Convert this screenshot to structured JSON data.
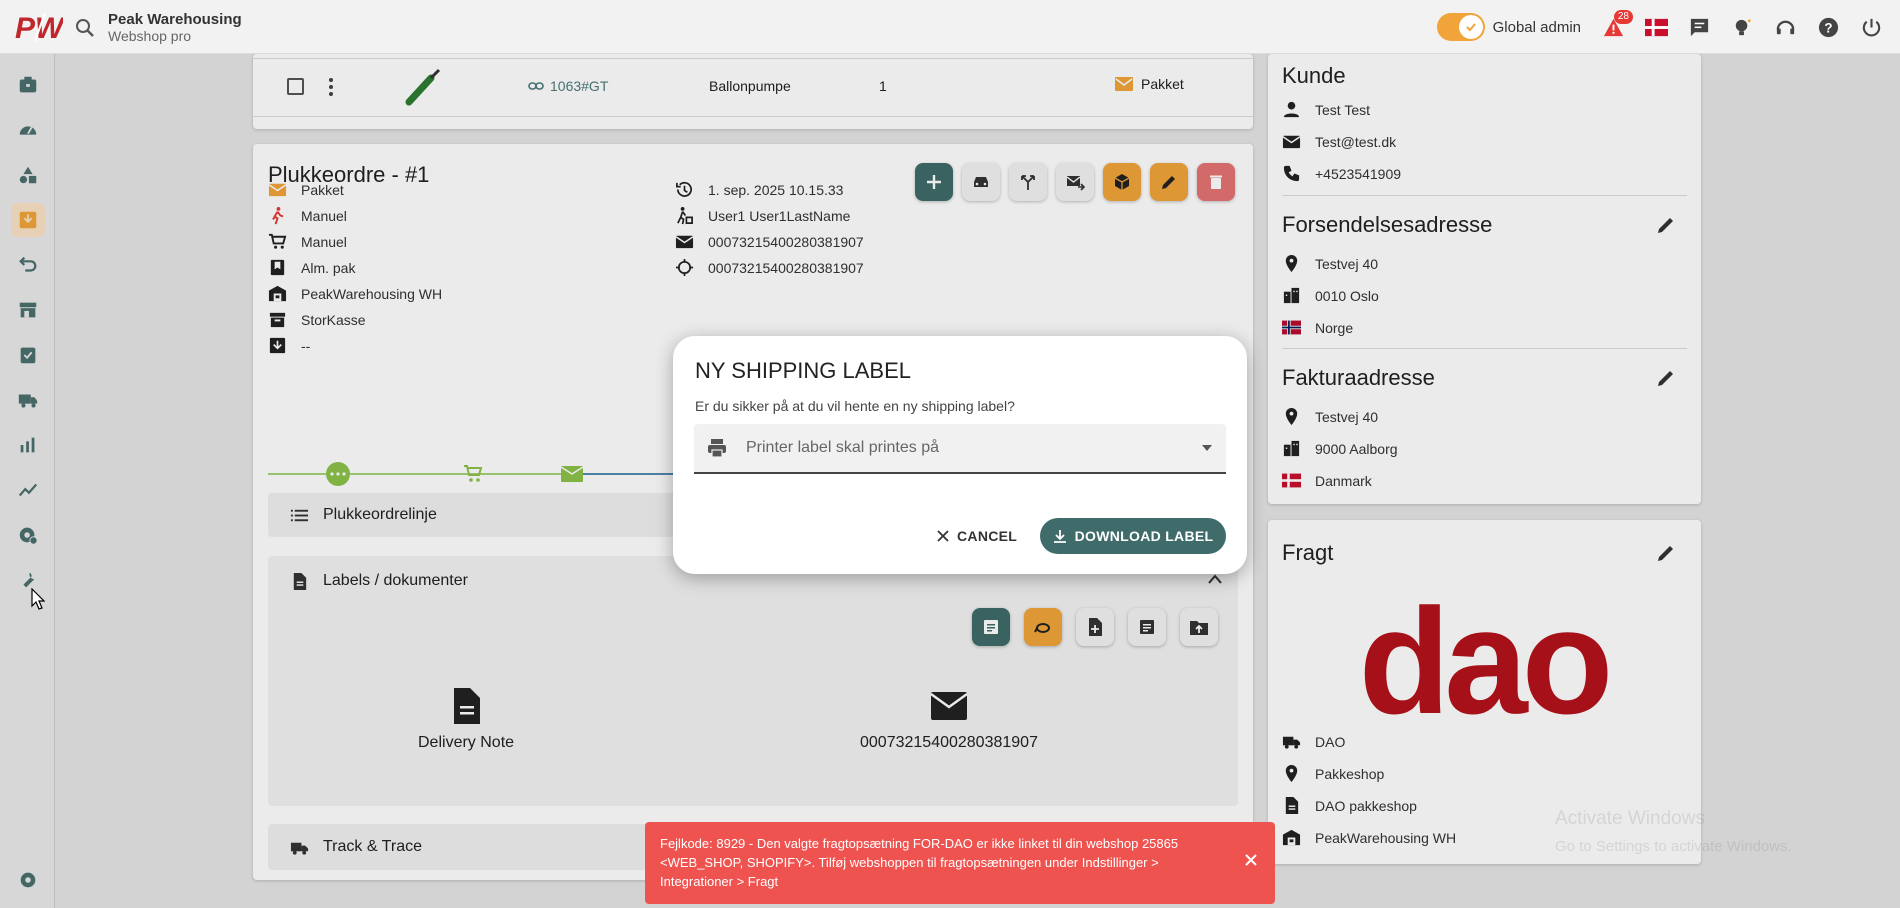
{
  "app": {
    "brand_name": "Peak Warehousing",
    "brand_sub": "Webshop pro",
    "logo_text": "PW"
  },
  "topbar": {
    "admin_label": "Global admin",
    "alert_count": "28",
    "icons": [
      "search-icon",
      "alert-icon",
      "flag-dk-icon",
      "chat-icon",
      "ideas-icon",
      "support-icon",
      "help-icon",
      "power-icon"
    ]
  },
  "sidebar": {
    "items": [
      "inventory-icon",
      "dashboard-icon",
      "products-icon",
      "orders-icon",
      "returns-icon",
      "store-icon",
      "receiving-icon",
      "shipping-icon",
      "analytics-icon",
      "trend-icon",
      "settings-gear-icon",
      "tools-icon",
      "settings-icon"
    ],
    "active_index": 3
  },
  "product_row": {
    "sku": "1063#GT",
    "name": "Ballonpumpe",
    "qty": "1",
    "shipping": "Pakket"
  },
  "order": {
    "title": "Plukkeordre - #1",
    "left_info": [
      {
        "icon": "mail-icon",
        "text": "Pakket"
      },
      {
        "icon": "walk-icon",
        "text": "Manuel"
      },
      {
        "icon": "cart-icon",
        "text": "Manuel"
      },
      {
        "icon": "bookmark-icon",
        "text": "Alm. pak"
      },
      {
        "icon": "warehouse-icon",
        "text": "PeakWarehousing WH"
      },
      {
        "icon": "box-icon",
        "text": "StorKasse"
      },
      {
        "icon": "download-box-icon",
        "text": "--"
      }
    ],
    "right_info": [
      {
        "icon": "history-icon",
        "text": "1. sep. 2025 10.15.33"
      },
      {
        "icon": "person-walk-icon",
        "text": "User1 User1LastName"
      },
      {
        "icon": "envelope-icon",
        "text": "00073215400280381907"
      },
      {
        "icon": "target-icon",
        "text": "00073215400280381907"
      }
    ],
    "accordion_lines": "Plukkeordrelinje",
    "accordion_labels": "Labels / dokumenter",
    "accordion_track": "Track & Trace",
    "documents": [
      {
        "icon": "document-icon",
        "label": "Delivery Note"
      },
      {
        "icon": "envelope-icon",
        "label": "00073215400280381907"
      }
    ],
    "colors": {
      "teal": "#3f6b6a",
      "orange": "#f0a43a",
      "red": "#e57373",
      "grey": "#f2f2f2"
    }
  },
  "customer": {
    "title": "Kunde",
    "name": "Test Test",
    "email": "Test@test.dk",
    "phone": "+4523541909"
  },
  "shipping_address": {
    "title": "Forsendelsesadresse",
    "street": "Testvej 40",
    "city": "0010 Oslo",
    "country": "Norge"
  },
  "invoice_address": {
    "title": "Fakturaadresse",
    "street": "Testvej 40",
    "city": "9000 Aalborg",
    "country": "Danmark"
  },
  "freight": {
    "title": "Fragt",
    "logo_text": "dao",
    "carrier": "DAO",
    "type": "Pakkeshop",
    "service": "DAO pakkeshop",
    "warehouse": "PeakWarehousing WH",
    "brand_color": "#b5121b"
  },
  "dialog": {
    "title": "NY SHIPPING LABEL",
    "text": "Er du sikker på at du vil hente en ny shipping label?",
    "select_placeholder": "Printer label skal printes på",
    "cancel_label": "CANCEL",
    "download_label": "DOWNLOAD LABEL"
  },
  "toast": {
    "message": "Fejlkode: 8929 - Den valgte fragtopsætning FOR-DAO er ikke linket til din webshop 25865 <WEB_SHOP, SHOPIFY>. Tilføj webshoppen til fragtopsætningen under Indstillinger > Integrationer > Fragt"
  },
  "watermark": {
    "line1": "Activate Windows",
    "line2": "Go to Settings to activate Windows."
  }
}
